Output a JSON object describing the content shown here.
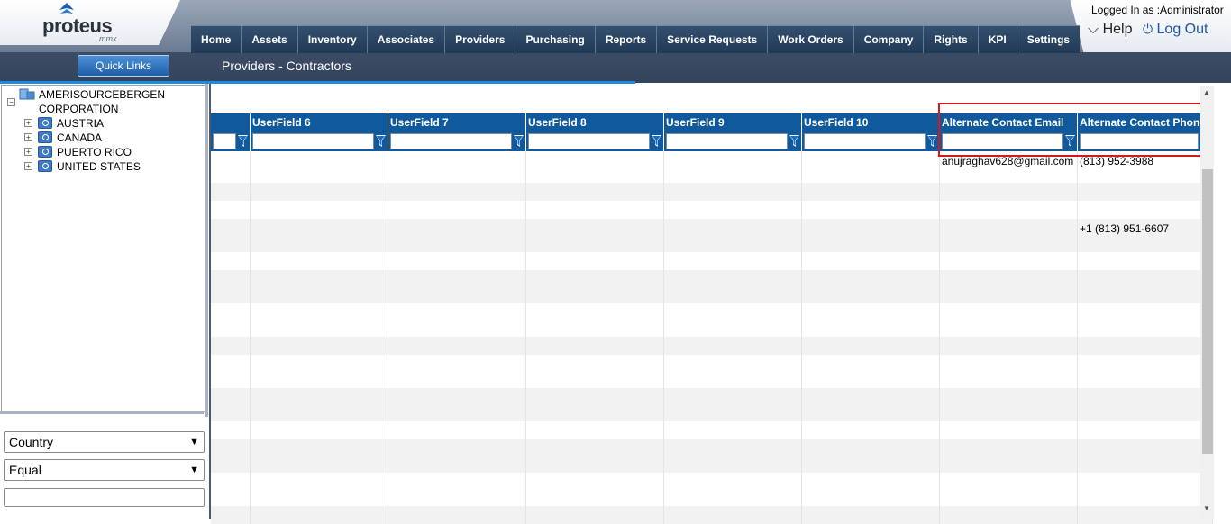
{
  "header": {
    "logo": "proteus",
    "logo_sub": "mmx",
    "logged_in": "Logged In as :Administrator",
    "help": "Help",
    "logout": "Log Out",
    "quick_links": "Quick Links",
    "page_title": "Providers - Contractors"
  },
  "nav": [
    "Home",
    "Assets",
    "Inventory",
    "Associates",
    "Providers",
    "Purchasing",
    "Reports",
    "Service Requests",
    "Work Orders",
    "Company",
    "Rights",
    "KPI",
    "Settings"
  ],
  "tree": {
    "root_line1": "AMERISOURCEBERGEN",
    "root_line2": "CORPORATION",
    "children": [
      "AUSTRIA",
      "CANADA",
      "PUERTO RICO",
      "UNITED STATES"
    ]
  },
  "filters": {
    "field": "Country",
    "operator": "Equal"
  },
  "grid": {
    "columns": [
      "",
      "UserField 6",
      "UserField 7",
      "UserField 8",
      "UserField 9",
      "UserField 10",
      "Alternate Contact Email",
      "Alternate Contact Phone"
    ],
    "rows": [
      [
        "",
        "",
        "",
        "",
        "",
        "",
        "anujraghav628@gmail.com",
        "(813) 952-3988"
      ],
      [
        "",
        "",
        "",
        "",
        "",
        "",
        "",
        ""
      ],
      [
        "",
        "",
        "",
        "",
        "",
        "",
        "",
        ""
      ],
      [
        "",
        "",
        "",
        "",
        "",
        "",
        "",
        "+1 (813) 951-6607"
      ],
      [
        "",
        "",
        "",
        "",
        "",
        "",
        "",
        ""
      ],
      [
        "",
        "",
        "",
        "",
        "",
        "",
        "",
        ""
      ],
      [
        "",
        "",
        "",
        "",
        "",
        "",
        "",
        ""
      ],
      [
        "",
        "",
        "",
        "",
        "",
        "",
        "",
        ""
      ],
      [
        "",
        "",
        "",
        "",
        "",
        "",
        "",
        ""
      ],
      [
        "",
        "",
        "",
        "",
        "",
        "",
        "",
        ""
      ],
      [
        "",
        "",
        "",
        "",
        "",
        "",
        "",
        ""
      ],
      [
        "",
        "",
        "",
        "",
        "",
        "",
        "",
        ""
      ],
      [
        "",
        "",
        "",
        "",
        "",
        "",
        "",
        ""
      ],
      [
        "",
        "",
        "",
        "",
        "",
        "",
        "",
        ""
      ]
    ]
  },
  "colors": {
    "grid_header": "#10599c",
    "highlight": "#d7191c",
    "nav": "#203a57"
  }
}
